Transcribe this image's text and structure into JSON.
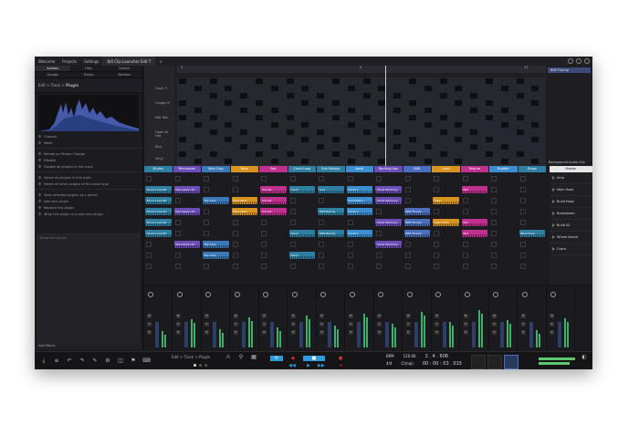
{
  "window": {
    "menu": [
      "Welcome",
      "Projects",
      "Settings"
    ],
    "tab_title": "8/4 Clip Launcher Edit T",
    "add_tab": "+"
  },
  "left_panel": {
    "tabs": [
      "Actions",
      "Files",
      "Search",
      "Groups",
      "Tracks",
      "Markers"
    ],
    "breadcrumb": [
      "Edit",
      "Track",
      "Plugin"
    ],
    "section_rows": [
      "Channel",
      "Mode"
    ],
    "actions_a": [
      "Remap on Tempo Change",
      "Disable",
      "Disable all plugins in this track"
    ],
    "actions_b": [
      "Select all plugins in this track",
      "Select all other plugins of the same type"
    ],
    "actions_c": [
      "Save selected plugins as a preset",
      "Add new plugin",
      "Replace this plugin",
      "Wrap this plugin in a new rack plugin"
    ],
    "drop_hint": "Show this plugin",
    "footer": "Add Macro"
  },
  "arranger": {
    "ruler_marks": [
      "1",
      "9",
      "17"
    ],
    "tracks": [
      "Clock 3",
      "Conga Hi",
      "Mid Tom",
      "Open Hi-Hat",
      "Kick",
      "Vinyl"
    ],
    "right_header": "808 Thump",
    "right_footer": "Background Audio Clip"
  },
  "clip_launcher": {
    "tracks": [
      {
        "name": "Drums",
        "color": "#2f7fa3"
      },
      {
        "name": "Percussion",
        "color": "#6d4db8"
      },
      {
        "name": "Verb Clap",
        "color": "#3b78b8"
      },
      {
        "name": "Bass",
        "color": "#d9941f"
      },
      {
        "name": "Pad",
        "color": "#c0308f"
      },
      {
        "name": "Clock Loop",
        "color": "#2f7fa3"
      },
      {
        "name": "Sub Melody",
        "color": "#2f7fa3"
      },
      {
        "name": "Vocal",
        "color": "#3b8fd1"
      },
      {
        "name": "Backing Vox",
        "color": "#6d4db8"
      },
      {
        "name": "808",
        "color": "#4a6fbf"
      },
      {
        "name": "Lead",
        "color": "#d9941f"
      },
      {
        "name": "Texture",
        "color": "#c0308f"
      },
      {
        "name": "Bubble",
        "color": "#3b8fd1"
      },
      {
        "name": "Drops",
        "color": "#2f7fa3"
      }
    ],
    "clip_labels": {
      "drums": [
        "Drum Loop 80",
        "Drum Loop 90",
        "Drum Loop 45",
        "Drum Loop 40",
        "Drum Loop 80"
      ],
      "perc": [
        "Percussion 45",
        "Percussion 45",
        "Percussion 45"
      ],
      "clap": [
        "Hip Clap",
        "Hip Clap",
        "Hip Clap"
      ],
      "bass": [
        "Bass Bass",
        "Bass Bass"
      ],
      "pad": [
        "Chords",
        "Chords",
        "Chords"
      ],
      "clock": [
        "Clock",
        "Clock",
        "Clock"
      ],
      "sub": [
        "Sub",
        "808 Melody",
        "808 Melody"
      ],
      "vocal": [
        "Vocal 1",
        "Vocal Main",
        "Vocal 1",
        "Vocal 1"
      ],
      "backing": [
        "Vocal Harmony",
        "Vocal Harmony",
        "Vocal Harmony",
        "Vocal Harmony"
      ],
      "t808": [
        "808 Thump",
        "808 Thump",
        "808 Thump"
      ],
      "lead": [
        "Lead",
        "Lead Hook"
      ],
      "texture": [
        "Pad",
        "Pad",
        "Pad"
      ],
      "drops": [
        "Bass Drop"
      ]
    },
    "master": "Master",
    "scenes": [
      "Intro",
      "Main Hook",
      "Build Hook",
      "Breakdown",
      "Build 02",
      "Whole Dance",
      "Outro"
    ]
  },
  "transport": {
    "breadcrumb": [
      "Edit",
      "Track",
      "Plugin"
    ],
    "bpm_label": "BPM",
    "bpm_value": "120.00",
    "sig_label": "4/4",
    "key_label": "C(maj)",
    "position": "2 . 4 . 606",
    "time": "00 : 00 : 03 . 015"
  },
  "colors": {
    "accent": "#2f9ad6",
    "record": "#d6362f",
    "meter": "#5dc86f"
  }
}
